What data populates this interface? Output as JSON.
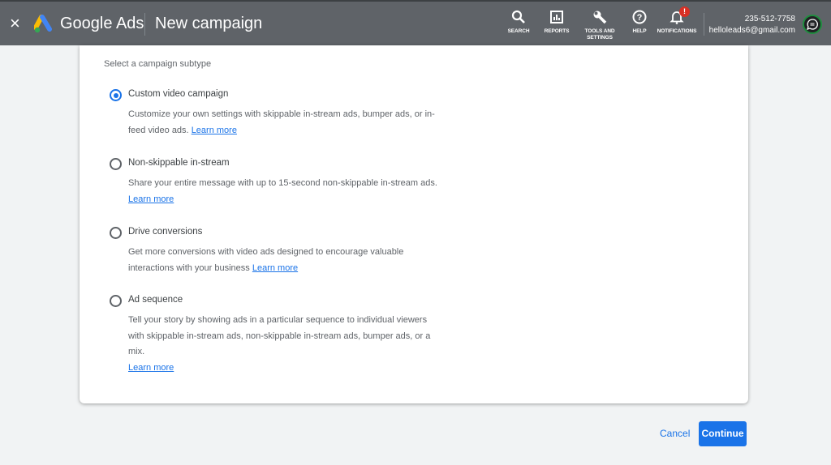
{
  "header": {
    "close_label": "×",
    "brand": "Google Ads",
    "title": "New campaign",
    "tools": [
      {
        "label": "SEARCH",
        "icon": "search-icon"
      },
      {
        "label": "REPORTS",
        "icon": "reports-icon"
      },
      {
        "label": "TOOLS AND SETTINGS",
        "icon": "wrench-icon"
      },
      {
        "label": "HELP",
        "icon": "help-icon"
      },
      {
        "label": "NOTIFICATIONS",
        "icon": "bell-icon",
        "badge": "!"
      }
    ],
    "account_phone": "235-512-7758",
    "account_email": "helloleads6@gmail.com"
  },
  "card": {
    "subtitle": "Select a campaign subtype",
    "options": [
      {
        "title": "Custom video campaign",
        "desc": "Customize your own settings with skippable in-stream ads, bumper ads, or in-feed video ads.",
        "link": "Learn more",
        "selected": true
      },
      {
        "title": "Non-skippable in-stream",
        "desc": "Share your entire message with up to 15-second non-skippable in-stream ads.",
        "link": "Learn more",
        "selected": false
      },
      {
        "title": "Drive conversions",
        "desc": "Get more conversions with video ads designed to encourage valuable interactions with your business",
        "link": "Learn more",
        "selected": false
      },
      {
        "title": "Ad sequence",
        "desc": "Tell your story by showing ads in a particular sequence to individual viewers with skippable in-stream ads, non-skippable in-stream ads, bumper ads, or a mix.",
        "link": "Learn more",
        "selected": false
      }
    ]
  },
  "footer": {
    "cancel": "Cancel",
    "continue": "Continue"
  },
  "colors": {
    "header": "#5f6368",
    "accent": "#1a73e8",
    "badge": "#d93025"
  }
}
